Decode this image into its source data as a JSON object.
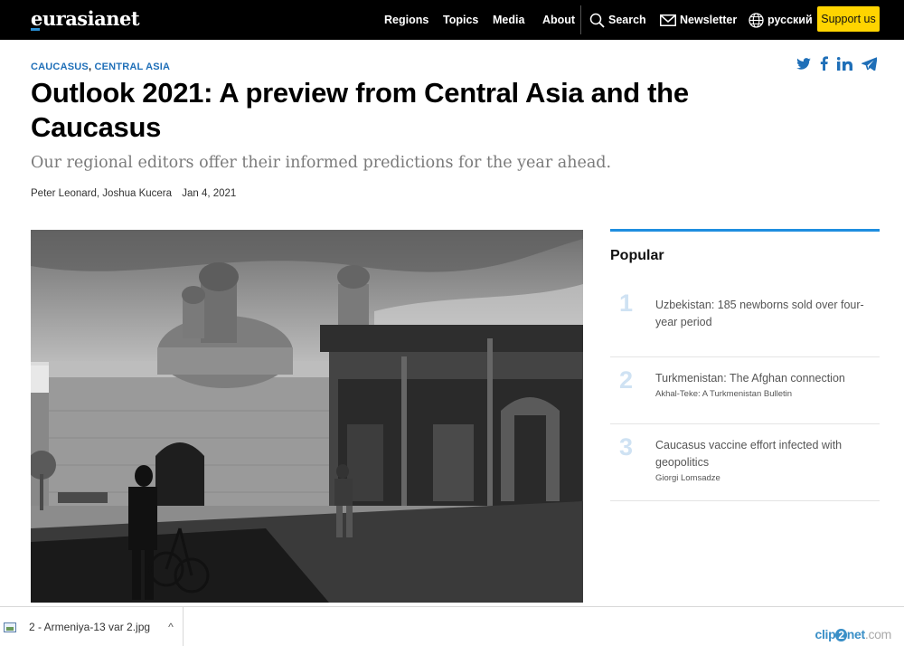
{
  "site": {
    "logo": "eurasianet"
  },
  "nav": {
    "regions": "Regions",
    "topics": "Topics",
    "media": "Media",
    "about": "About",
    "search": "Search",
    "newsletter": "Newsletter",
    "language": "русский",
    "support": "Support us"
  },
  "article": {
    "categories": [
      "CAUCASUS",
      "CENTRAL ASIA"
    ],
    "category_separator": ",",
    "title": "Outlook 2021: A preview from Central Asia and the Caucasus",
    "dek": "Our regional editors offer their informed predictions for the year ahead.",
    "authors": [
      "Peter Leonard",
      "Joshua Kucera"
    ],
    "author_separator": ",",
    "date": "Jan 4, 2021"
  },
  "share_icons": [
    "twitter-icon",
    "facebook-icon",
    "linkedin-icon",
    "telegram-icon"
  ],
  "popular": {
    "title": "Popular",
    "items": [
      {
        "num": "1",
        "title": "Uzbekistan: 185 newborns sold over four-year period",
        "sub": ""
      },
      {
        "num": "2",
        "title": "Turkmenistan: The Afghan connection",
        "sub": "Akhal-Teke: A Turkmenistan Bulletin"
      },
      {
        "num": "3",
        "title": "Caucasus vaccine effort infected with geopolitics",
        "sub": "Giorgi Lomsadze"
      }
    ]
  },
  "download_bar": {
    "filename": "2 - Armeniya-13 var 2.jpg",
    "chevron": "^"
  },
  "watermark": {
    "part1": "clip",
    "part2": "2",
    "part3": "net",
    "part4": ".com"
  },
  "colors": {
    "accent": "#1f6fb8",
    "support_button": "#ffd400",
    "sidebar_rule": "#1f8ee0"
  }
}
